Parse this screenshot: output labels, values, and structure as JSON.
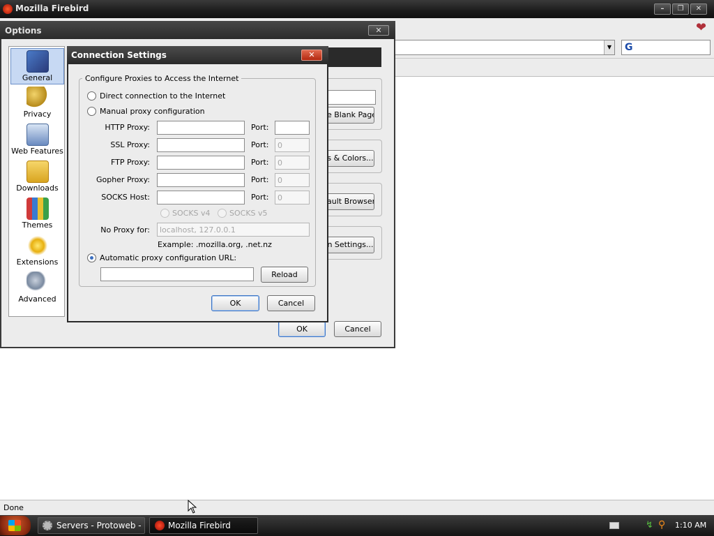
{
  "browser": {
    "title": "Mozilla Firebird",
    "status": "Done",
    "search_engine_badge": "G"
  },
  "taskbar": {
    "tasks": [
      {
        "label": "Servers - Protoweb - ..."
      },
      {
        "label": "Mozilla Firebird"
      }
    ],
    "clock": "1:10 AM"
  },
  "options": {
    "title": "Options",
    "sidebar": [
      {
        "label": "General",
        "icon": "general-icon",
        "selected": true
      },
      {
        "label": "Privacy",
        "icon": "privacy-key-icon"
      },
      {
        "label": "Web Features",
        "icon": "web-features-icon"
      },
      {
        "label": "Downloads",
        "icon": "downloads-folder-icon"
      },
      {
        "label": "Themes",
        "icon": "themes-icon"
      },
      {
        "label": "Extensions",
        "icon": "extensions-icon"
      },
      {
        "label": "Advanced",
        "icon": "advanced-gears-icon"
      }
    ],
    "fragments": {
      "blank_page": "e Blank Page",
      "colors": "s & Colors...",
      "default_browser": "ault Browser",
      "conn_settings": "n Settings..."
    },
    "ok": "OK",
    "cancel": "Cancel"
  },
  "connection": {
    "title": "Connection Settings",
    "group_label": "Configure Proxies to Access the Internet",
    "direct_label": "Direct connection to the Internet",
    "manual_label": "Manual proxy configuration",
    "proxies": [
      {
        "label": "HTTP Proxy:",
        "host": "",
        "port": ""
      },
      {
        "label": "SSL Proxy:",
        "host": "",
        "port": "0"
      },
      {
        "label": "FTP Proxy:",
        "host": "",
        "port": "0"
      },
      {
        "label": "Gopher Proxy:",
        "host": "",
        "port": "0"
      },
      {
        "label": "SOCKS Host:",
        "host": "",
        "port": "0"
      }
    ],
    "port_label": "Port:",
    "socks_v4": "SOCKS v4",
    "socks_v5": "SOCKS v5",
    "no_proxy_label": "No Proxy for:",
    "no_proxy_value": "localhost, 127.0.0.1",
    "example": "Example: .mozilla.org, .net.nz",
    "auto_label": "Automatic proxy configuration URL:",
    "auto_url": "",
    "reload": "Reload",
    "ok": "OK",
    "cancel": "Cancel",
    "selected_mode": "automatic"
  }
}
